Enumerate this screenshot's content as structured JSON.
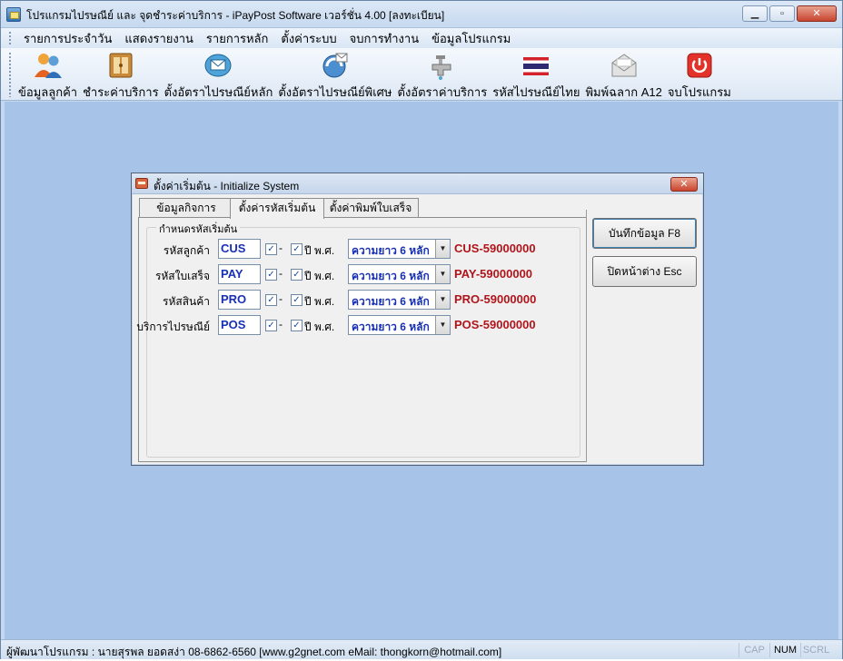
{
  "window": {
    "title": "โปรแกรมไปรษณีย์ และ จุดชำระค่าบริการ - iPayPost Software เวอร์ชั่น 4.00 [ลงทะเบียน]"
  },
  "menu": [
    "รายการประจำวัน",
    "แสดงรายงาน",
    "รายการหลัก",
    "ตั้งค่าระบบ",
    "จบการทำงาน",
    "ข้อมูลโปรแกรม"
  ],
  "toolbar": [
    {
      "label": "ข้อมูลลูกค้า",
      "icon": "customers-icon"
    },
    {
      "label": "ชำระค่าบริการ",
      "icon": "payment-icon"
    },
    {
      "label": "ตั้งอัตราไปรษณีย์หลัก",
      "icon": "mail-rate-icon"
    },
    {
      "label": "ตั้งอัตราไปรษณีย์พิเศษ",
      "icon": "special-rate-icon"
    },
    {
      "label": "ตั้งอัตราค่าบริการ",
      "icon": "service-rate-icon"
    },
    {
      "label": "รหัสไปรษณีย์ไทย",
      "icon": "thai-flag-icon"
    },
    {
      "label": "พิมพ์ฉลาก A12",
      "icon": "envelope-icon"
    },
    {
      "label": "จบโปรแกรม",
      "icon": "power-icon"
    }
  ],
  "dialog": {
    "title": "ตั้งค่าเริ่มต้น - Initialize System",
    "tabs": [
      "ข้อมูลกิจการ",
      "ตั้งค่ารหัสเริ่มต้น",
      "ตั้งค่าพิมพ์ใบเสร็จ"
    ],
    "active_tab": 1,
    "group_title": "กำหนดรหัสเริ่มต้น",
    "dash": "-",
    "year_label": "ปี พ.ศ.",
    "rows": [
      {
        "label": "รหัสลูกค้า",
        "prefix": "CUS",
        "length": "ความยาว 6 หลัก",
        "example": "CUS-59000000"
      },
      {
        "label": "รหัสใบเสร็จ",
        "prefix": "PAY",
        "length": "ความยาว 6 หลัก",
        "example": "PAY-59000000"
      },
      {
        "label": "รหัสสินค้า",
        "prefix": "PRO",
        "length": "ความยาว 6 หลัก",
        "example": "PRO-59000000"
      },
      {
        "label": "บริการไปรษณีย์",
        "prefix": "POS",
        "length": "ความยาว 6 หลัก",
        "example": "POS-59000000"
      }
    ],
    "save_button": "บันทึกข้อมูล F8",
    "close_button": "ปิดหน้าต่าง Esc"
  },
  "status": {
    "text": "ผู้พัฒนาโปรแกรม : นายสุรพล ยอดสง่า 08-6862-6560  [www.g2gnet.com  eMail: thongkorn@hotmail.com]",
    "keys": [
      {
        "label": "CAP",
        "active": false
      },
      {
        "label": "NUM",
        "active": true
      },
      {
        "label": "SCRL",
        "active": false
      }
    ]
  },
  "colors": {
    "mdi_background": "#a7c4e8",
    "prefix_text": "#1830b5",
    "example_text": "#b0151b"
  }
}
